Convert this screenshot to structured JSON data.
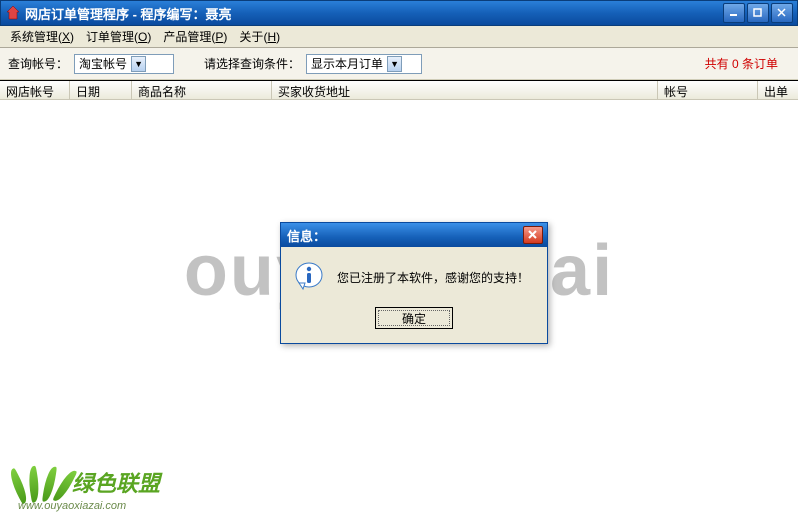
{
  "window": {
    "title": "网店订单管理程序 - 程序编写：聂亮"
  },
  "menu": {
    "items": [
      {
        "label": "系统管理",
        "mnemonic": "X"
      },
      {
        "label": "订单管理",
        "mnemonic": "O"
      },
      {
        "label": "产品管理",
        "mnemonic": "P"
      },
      {
        "label": "关于",
        "mnemonic": "H"
      }
    ]
  },
  "toolbar": {
    "account_label": "查询帐号：",
    "account_value": "淘宝帐号",
    "condition_label": "请选择查询条件：",
    "condition_value": "显示本月订单",
    "status_text": "共有 0 条订单"
  },
  "columns": {
    "c0": "网店帐号",
    "c1": "日期",
    "c2": "商品名称",
    "c3": "买家收货地址",
    "c4": "帐号",
    "c5": "出单"
  },
  "dialog": {
    "title": "信息：",
    "message": "您已注册了本软件，感谢您的支持！",
    "ok_label": "确定"
  },
  "watermark": "ouyaoxiazai",
  "footer": {
    "brand": "绿色联盟",
    "url": "www.ouyaoxiazai.com"
  }
}
